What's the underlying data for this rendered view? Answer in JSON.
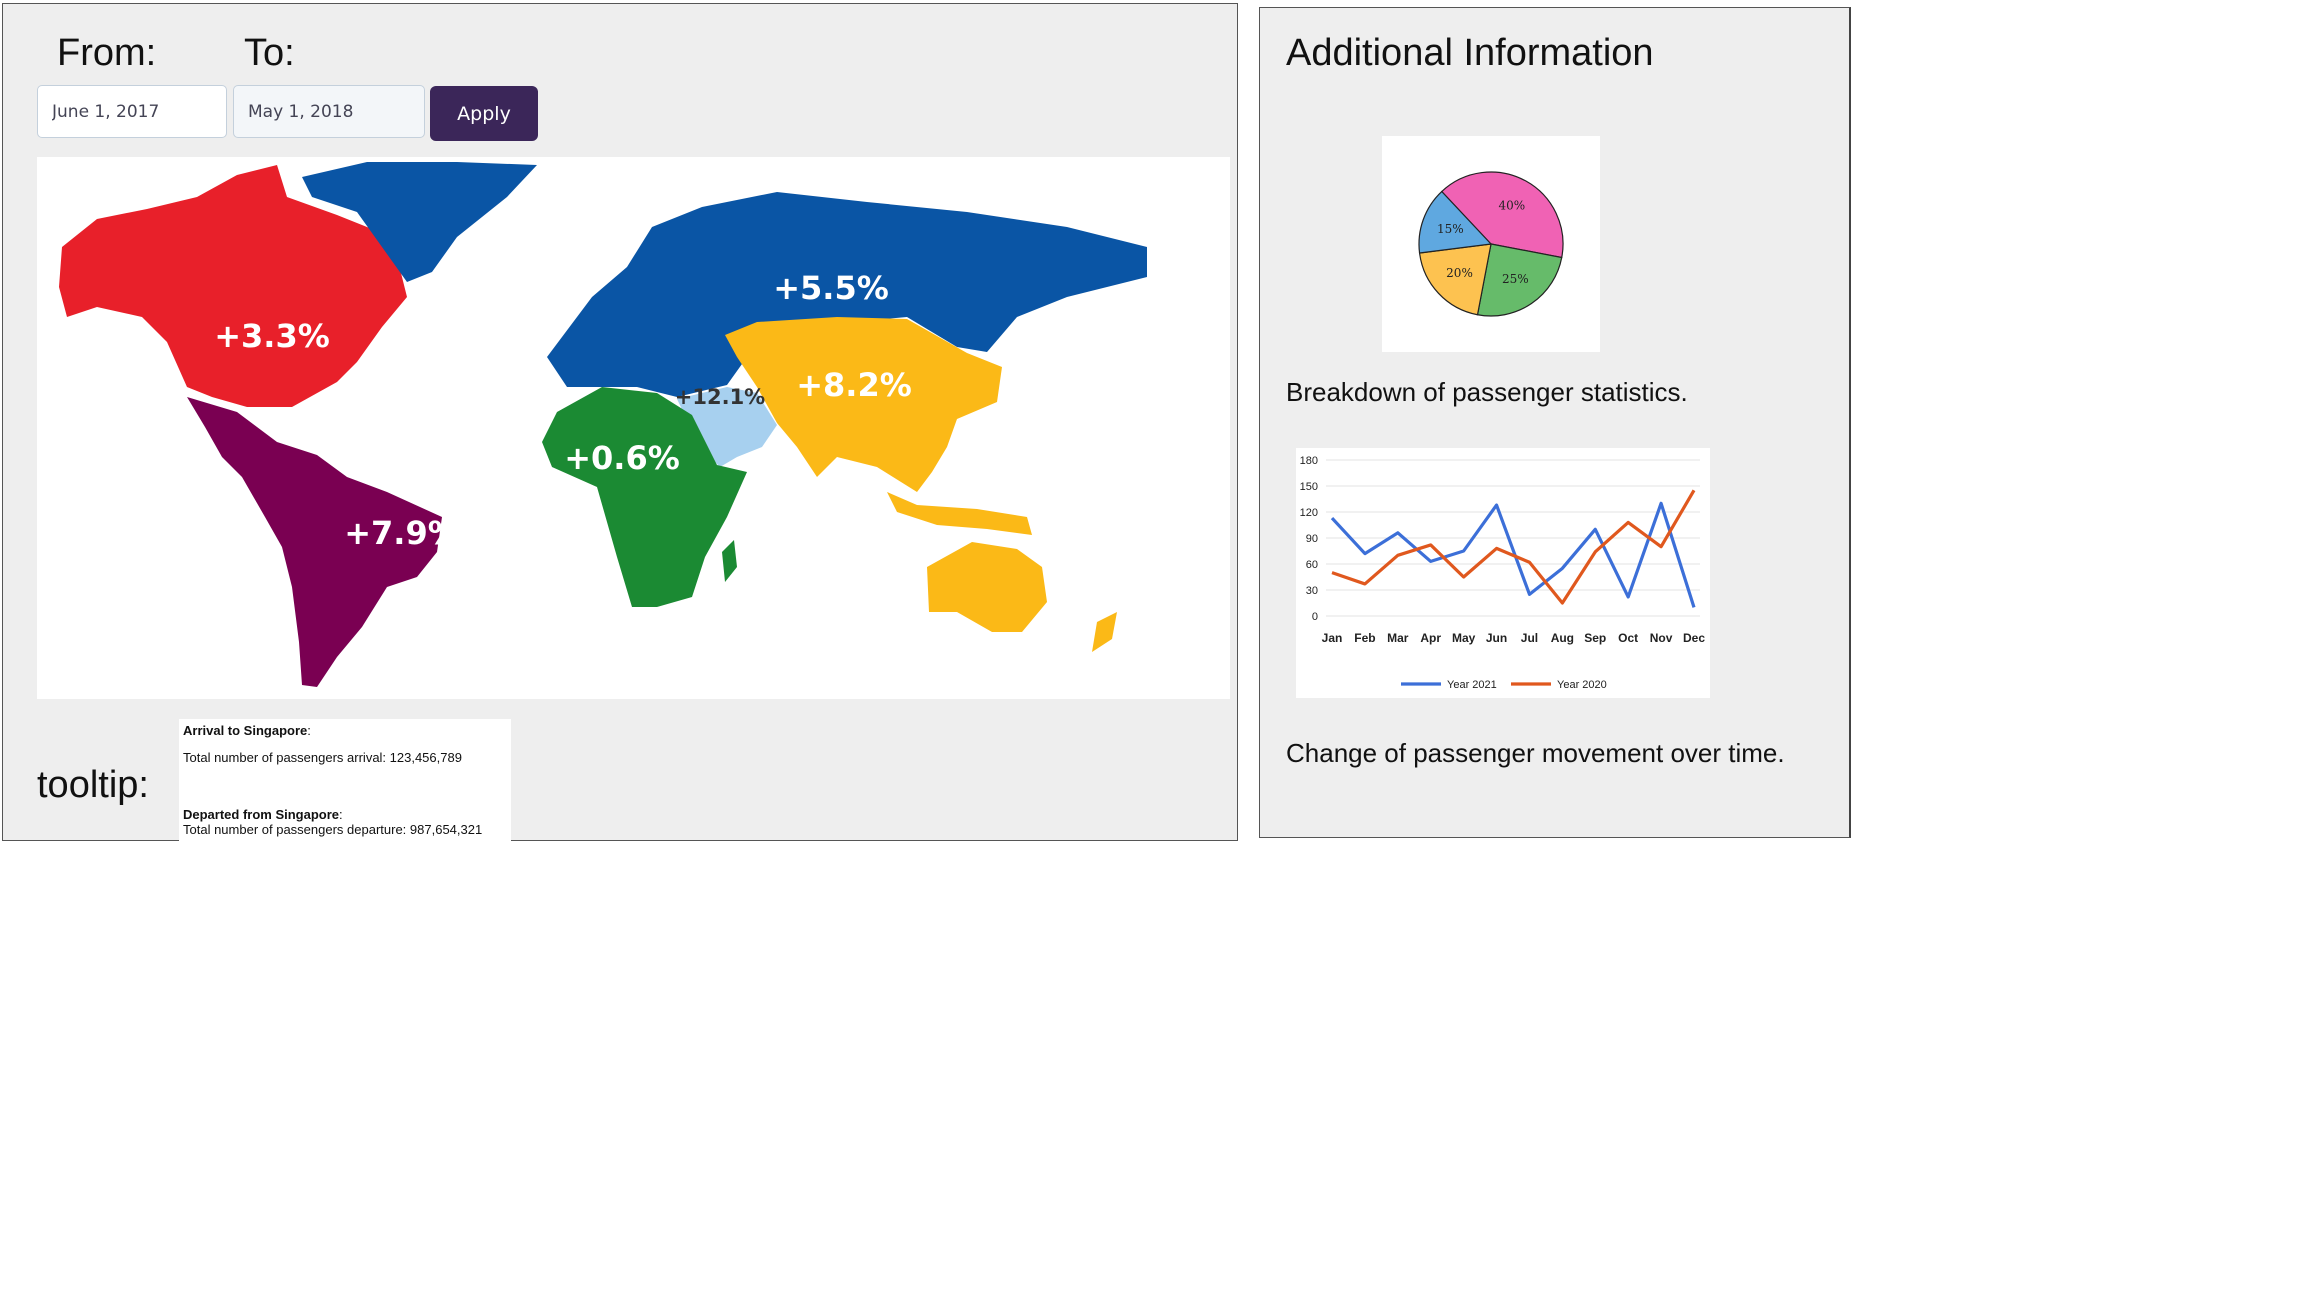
{
  "filters": {
    "from_label": "From:",
    "to_label": "To:",
    "from_value": "June 1, 2017",
    "to_value": "May 1, 2018",
    "apply_label": "Apply"
  },
  "map": {
    "regions": [
      {
        "name": "north-america",
        "label": "+3.3%",
        "color": "#e8202a"
      },
      {
        "name": "europe-russia",
        "label": "+5.5%",
        "color": "#0a55a5"
      },
      {
        "name": "asia",
        "label": "+8.2%",
        "color": "#fbb917"
      },
      {
        "name": "africa",
        "label": "+0.6%",
        "color": "#1b8a33"
      },
      {
        "name": "middle-east",
        "label": "+12.1%",
        "color": "#a7d0ef"
      },
      {
        "name": "latin-america",
        "label": "+7.9%",
        "color": "#7a0052"
      }
    ]
  },
  "tooltip": {
    "label": "tooltip:",
    "arrival_title": "Arrival to Singapore",
    "arrival_text": "Total number of passengers arrival: 123,456,789",
    "departure_title": "Departed from Singapore",
    "departure_text": "Total number of passengers departure: 987,654,321"
  },
  "side": {
    "title": "Additional Information",
    "pie_caption": "Breakdown of passenger statistics.",
    "line_caption": "Change of passenger movement over time."
  },
  "chart_data": [
    {
      "type": "pie",
      "slices": [
        {
          "label": "40%",
          "value": 40,
          "color": "#f062b4"
        },
        {
          "label": "25%",
          "value": 25,
          "color": "#66bb6a"
        },
        {
          "label": "20%",
          "value": 20,
          "color": "#fdc250"
        },
        {
          "label": "15%",
          "value": 15,
          "color": "#5fa8e0"
        }
      ]
    },
    {
      "type": "line",
      "categories": [
        "Jan",
        "Feb",
        "Mar",
        "Apr",
        "May",
        "Jun",
        "Jul",
        "Aug",
        "Sep",
        "Oct",
        "Nov",
        "Dec"
      ],
      "ylim": [
        0,
        180
      ],
      "yticks": [
        0,
        30,
        60,
        90,
        120,
        150,
        180
      ],
      "grid": true,
      "legend": "bottom",
      "series": [
        {
          "name": "Year 2021",
          "color": "#3c6fd8",
          "values": [
            113,
            72,
            96,
            63,
            75,
            128,
            25,
            55,
            100,
            22,
            130,
            10
          ]
        },
        {
          "name": "Year 2020",
          "color": "#e0581e",
          "values": [
            50,
            37,
            70,
            82,
            45,
            78,
            62,
            15,
            74,
            108,
            80,
            145
          ]
        }
      ]
    }
  ]
}
